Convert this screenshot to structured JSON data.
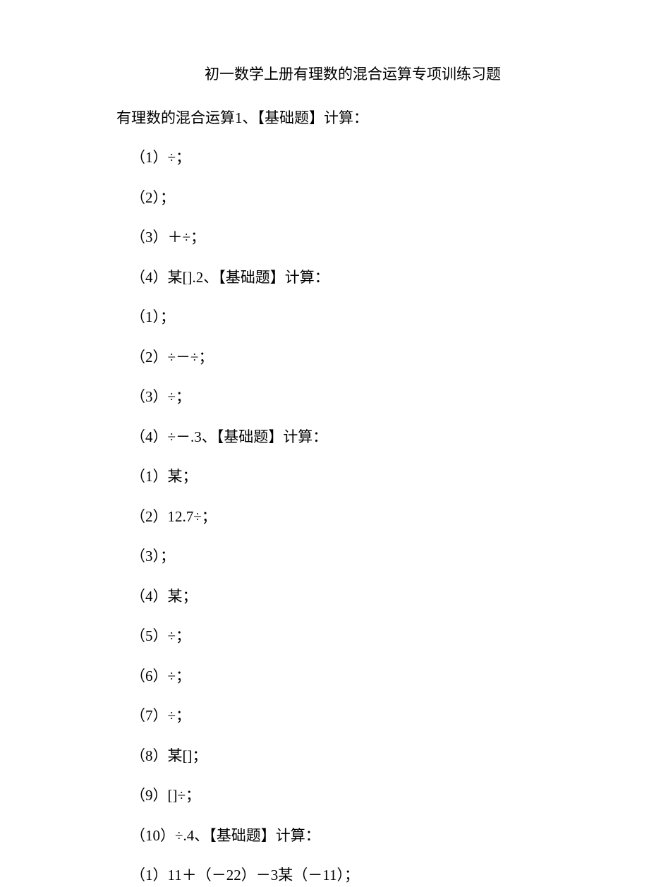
{
  "title": "初一数学上册有理数的混合运算专项训练习题",
  "intro": "有理数的混合运算1、【基础题】计算：",
  "items": [
    "（1）÷；",
    "（2）；",
    "（3）＋÷；",
    "（4）某[].2、【基础题】计算：",
    "（1）；",
    "（2）÷－÷；",
    "（3）÷；",
    "（4）÷－.3、【基础题】计算：",
    "（1）某；",
    "（2）12.7÷；",
    "（3）；",
    "（4）某；",
    "（5）÷；",
    "（6）÷；",
    "（7）÷；",
    "（8）某[]；",
    "（9）[]÷；",
    "（10）÷.4、【基础题】计算：",
    "（1）11＋（－22）－3某（－11）；"
  ]
}
